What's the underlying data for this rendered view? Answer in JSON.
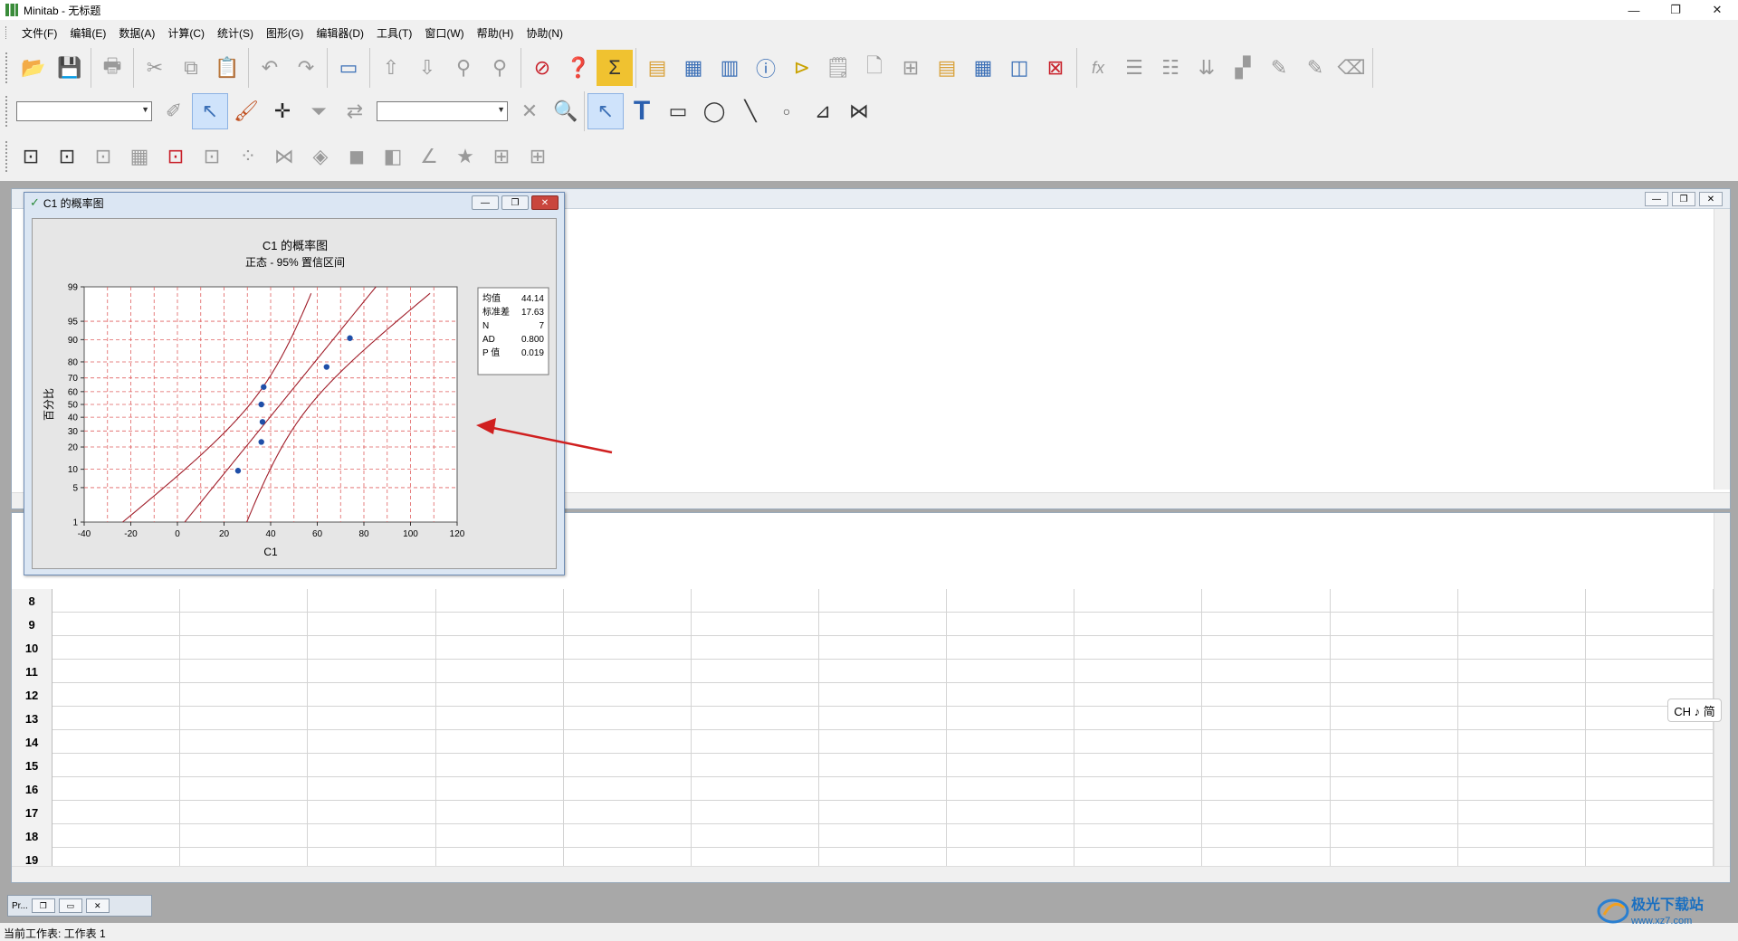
{
  "window": {
    "title": "Minitab - 无标题",
    "minimize": "—",
    "restore": "❐",
    "close": "✕"
  },
  "menu": [
    "文件(F)",
    "编辑(E)",
    "数据(A)",
    "计算(C)",
    "统计(S)",
    "图形(G)",
    "编辑器(D)",
    "工具(T)",
    "窗口(W)",
    "帮助(H)",
    "协助(N)"
  ],
  "graph_window": {
    "title": "C1 的概率图"
  },
  "chart_data": {
    "type": "scatter",
    "title": "C1 的概率图",
    "subtitle": "正态 - 95% 置信区间",
    "xlabel": "C1",
    "ylabel": "百分比",
    "xlim": [
      -40,
      120
    ],
    "x_ticks": [
      "-40",
      "-20",
      "0",
      "20",
      "40",
      "60",
      "80",
      "100",
      "120"
    ],
    "y_ticks": [
      "1",
      "5",
      "10",
      "20",
      "30",
      "40",
      "50",
      "60",
      "70",
      "80",
      "90",
      "95",
      "99"
    ],
    "y_scale": "normal-probability",
    "grid": true,
    "points": [
      {
        "x": 26,
        "p": 9.5
      },
      {
        "x": 36,
        "p": 22.9
      },
      {
        "x": 36.5,
        "p": 36.5
      },
      {
        "x": 36,
        "p": 50
      },
      {
        "x": 37,
        "p": 63.5
      },
      {
        "x": 64,
        "p": 77.1
      },
      {
        "x": 74,
        "p": 90.5
      }
    ],
    "fit": {
      "mean": 44.14,
      "sd": 17.63
    },
    "stats_box": [
      {
        "label": "均值",
        "value": "44.14"
      },
      {
        "label": "标准差",
        "value": "17.63"
      },
      {
        "label": "N",
        "value": "7"
      },
      {
        "label": "AD",
        "value": "0.800"
      },
      {
        "label": "P 值",
        "value": "0.019"
      }
    ],
    "colors": {
      "points": "#1f4fa8",
      "lines": "#a01e2a",
      "grid": "#e06060",
      "plot_bg": "#ffffff",
      "frame_bg": "#e6e6e6"
    }
  },
  "worksheet": {
    "rows": [
      "8",
      "9",
      "10",
      "11",
      "12",
      "13",
      "14",
      "15",
      "16",
      "17",
      "18",
      "19"
    ]
  },
  "taskbar": {
    "mini_window": "Pr..."
  },
  "ime": "CH ♪ 简",
  "status": "当前工作表: 工作表 1",
  "watermark": {
    "text": "极光下载站",
    "url": "www.xz7.com"
  }
}
